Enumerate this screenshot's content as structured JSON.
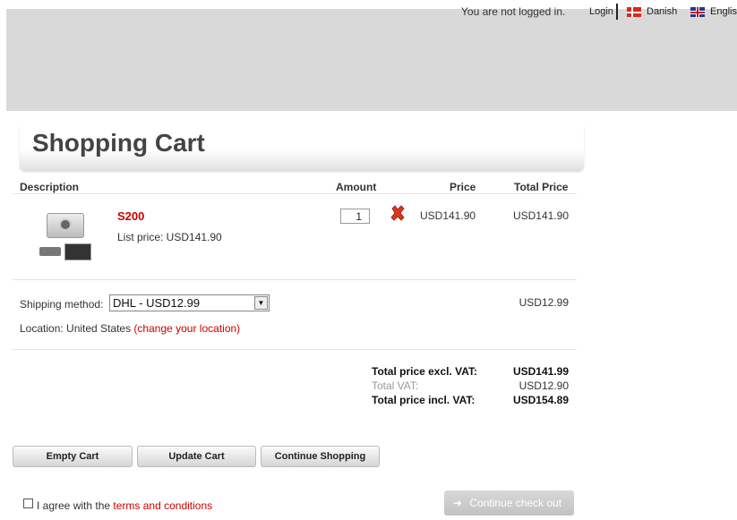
{
  "header": {
    "login_status": "You are not logged in.",
    "login_link": "Login",
    "languages": [
      {
        "label": "Danish",
        "icon": "denmark-flag-icon"
      },
      {
        "label": "English",
        "icon": "uk-flag-icon"
      }
    ]
  },
  "page_title": "Shopping Cart",
  "table": {
    "columns": {
      "description": "Description",
      "amount": "Amount",
      "price": "Price",
      "total": "Total Price"
    }
  },
  "items": [
    {
      "name": "S200",
      "list_price": "List price: USD141.90",
      "amount": "1",
      "price": "USD141.90",
      "total": "USD141.90"
    }
  ],
  "shipping": {
    "label": "Shipping method:",
    "selected": "DHL - USD12.99",
    "price": "USD12.99",
    "location_text": "Location: United States",
    "location_link": "(change your location)"
  },
  "summary": {
    "excl_label": "Total price excl. VAT:",
    "excl_value": "USD141.99",
    "vat_label": "Total VAT:",
    "vat_value": "USD12.90",
    "incl_label": "Total price incl. VAT:",
    "incl_value": "USD154.89"
  },
  "buttons": {
    "empty": "Empty Cart",
    "update": "Update Cart",
    "continue_shopping": "Continue Shopping"
  },
  "agreement": {
    "text": "I agree with the",
    "link": "terms and conditions",
    "checked": false
  },
  "checkout": {
    "label": "Continue check out",
    "enabled": false
  },
  "colors": {
    "accent": "#cc0000",
    "header_bg": "#d9d9d9",
    "checkout_disabled": "#cccccc"
  }
}
